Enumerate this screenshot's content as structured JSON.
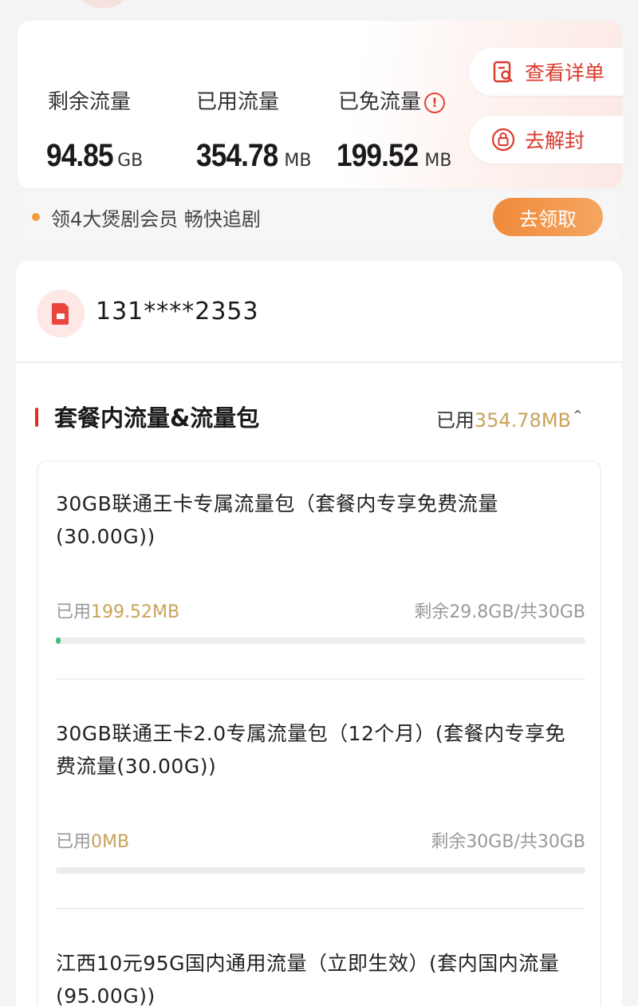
{
  "summary": {
    "remaining": {
      "label": "剩余流量",
      "value": "94.85",
      "unit": "GB"
    },
    "used": {
      "label": "已用流量",
      "value": "354.78",
      "unit": "MB"
    },
    "free": {
      "label": "已免流量",
      "value": "199.52",
      "unit": "MB"
    },
    "info_glyph": "!",
    "details_button": "查看详单",
    "unblock_button": "去解封"
  },
  "promo": {
    "text": "领4大煲剧会员 畅快追剧",
    "button": "去领取"
  },
  "account": {
    "phone": "131****2353"
  },
  "section": {
    "title": "套餐内流量&流量包",
    "used_prefix": "已用",
    "used_value": "354.78MB",
    "chevron": "⌃"
  },
  "packages": [
    {
      "name": "30GB联通王卡专属流量包（套餐内专享免费流量(30.00G))",
      "used_prefix": "已用",
      "used_value": "199.52MB",
      "remaining": "剩余29.8GB/共30GB",
      "progress": 0.0065
    },
    {
      "name": "30GB联通王卡2.0专属流量包（12个月）(套餐内专享免费流量(30.00G))",
      "used_prefix": "已用",
      "used_value": "0MB",
      "remaining": "剩余30GB/共30GB",
      "progress": 0
    },
    {
      "name": "江西10元95G国内通用流量（立即生效）(套内国内流量(95.00G))"
    }
  ],
  "colors": {
    "accent_red": "#e02e24",
    "gold": "#c9a25a",
    "progress_green": "#3cc07a",
    "promo_orange": "#f08a3c"
  },
  "icons": [
    "info-icon",
    "document-search-icon",
    "lock-icon",
    "sim-card-icon",
    "chevron-up-icon"
  ]
}
